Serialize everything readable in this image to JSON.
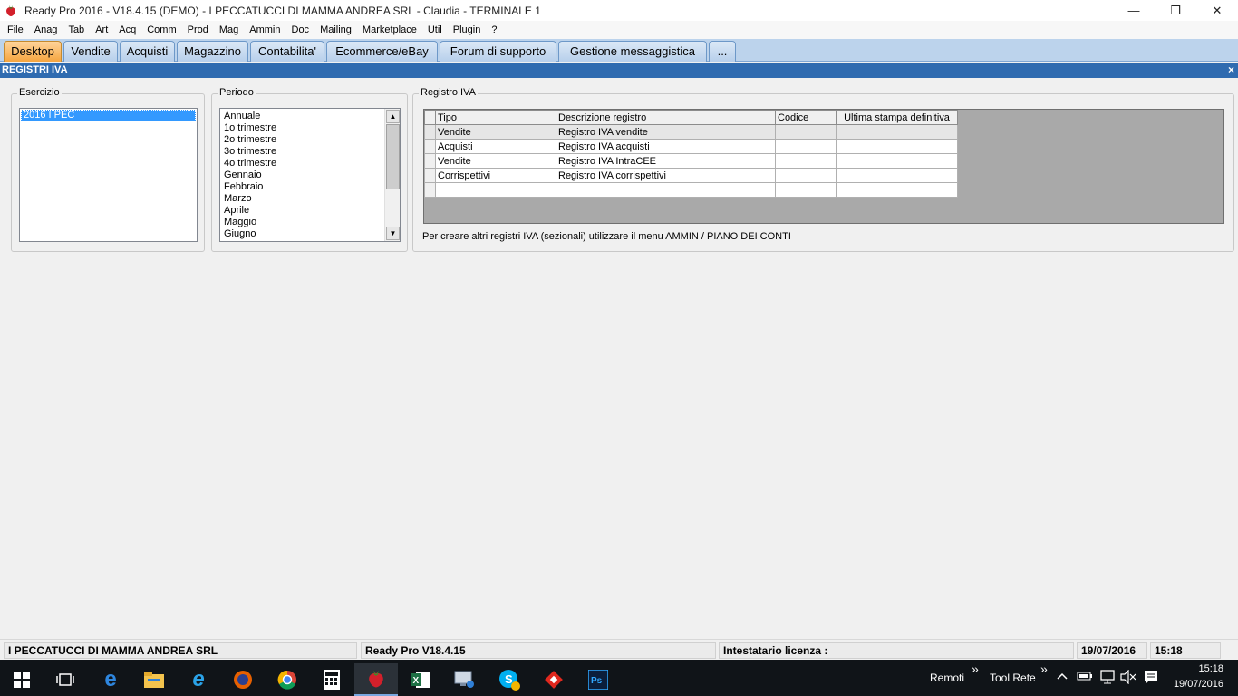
{
  "window": {
    "title": "Ready Pro 2016 - V18.4.15 (DEMO)  - I PECCATUCCI DI MAMMA ANDREA SRL - Claudia - TERMINALE 1",
    "minimize": "—",
    "maximize": "❐",
    "close": "✕"
  },
  "menu": [
    "File",
    "Anag",
    "Tab",
    "Art",
    "Acq",
    "Comm",
    "Prod",
    "Mag",
    "Ammin",
    "Doc",
    "Mailing",
    "Marketplace",
    "Util",
    "Plugin",
    "?"
  ],
  "tabs": [
    "Desktop",
    "Vendite",
    "Acquisti",
    "Magazzino",
    "Contabilita'",
    "Ecommerce/eBay",
    "Forum di supporto",
    "Gestione messaggistica",
    "..."
  ],
  "active_tab": "Desktop",
  "panel": {
    "title": "REGISTRI IVA",
    "close": "×"
  },
  "esercizio": {
    "label": "Esercizio",
    "items": [
      "2016 I PEC"
    ]
  },
  "periodo": {
    "label": "Periodo",
    "items": [
      "Annuale",
      "1o trimestre",
      "2o trimestre",
      "3o trimestre",
      "4o trimestre",
      "Gennaio",
      "Febbraio",
      "Marzo",
      "Aprile",
      "Maggio",
      "Giugno"
    ],
    "scroll_up": "▲",
    "scroll_down": "▼"
  },
  "registro": {
    "label": "Registro IVA",
    "columns": [
      "Tipo",
      "Descrizione registro",
      "Codice",
      "Ultima stampa definitiva"
    ],
    "rows": [
      [
        "Vendite",
        "Registro IVA vendite",
        "",
        ""
      ],
      [
        "Acquisti",
        "Registro IVA acquisti",
        "",
        ""
      ],
      [
        "Vendite",
        "Registro IVA IntraCEE",
        "",
        ""
      ],
      [
        "Corrispettivi",
        "Registro IVA corrispettivi",
        "",
        ""
      ],
      [
        "",
        "",
        "",
        ""
      ]
    ],
    "note": "Per creare altri registri IVA (sezionali) utilizzare il menu AMMIN / PIANO DEI CONTI"
  },
  "status": {
    "company": "I PECCATUCCI DI MAMMA ANDREA SRL",
    "version": "Ready Pro V18.4.15",
    "license": "Intestatario licenza :",
    "date": "19/07/2016",
    "time": "15:18"
  },
  "taskbar": {
    "apps": [
      "start-icon",
      "task-view-icon",
      "edge-icon",
      "file-explorer-icon",
      "internet-explorer-icon",
      "firefox-icon",
      "chrome-icon",
      "calculator-icon",
      "readypro-icon",
      "excel-icon",
      "remote-desktop-icon",
      "skype-icon",
      "anydesk-icon",
      "photoshop-icon"
    ],
    "toolbars": [
      "Remoti",
      "Tool Rete"
    ],
    "chevron": "»",
    "clock_time": "15:18",
    "clock_date": "19/07/2016"
  },
  "colors": {
    "tab_active": "#f5a540",
    "tab_bg": "#bcd3ec",
    "panel_header": "#2f6bb0",
    "selection": "#3399ff",
    "taskbar": "#101418"
  }
}
